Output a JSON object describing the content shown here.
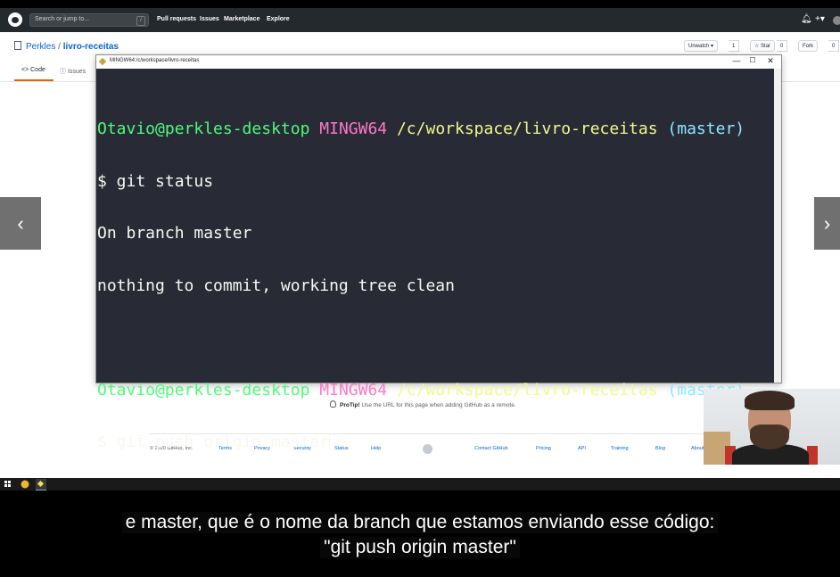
{
  "github": {
    "search_placeholder": "Search or jump to...",
    "search_key": "/",
    "nav": [
      "Pull requests",
      "Issues",
      "Marketplace",
      "Explore"
    ],
    "right_icons": [
      "bell-icon",
      "plus-icon",
      "avatar"
    ]
  },
  "repo": {
    "owner": "Perkles",
    "separator": " / ",
    "name": "livro-receitas",
    "unwatch_label": "Unwatch ▾",
    "unwatch_count": "1",
    "star_label": "☆ Star",
    "star_count": "0",
    "fork_label": "Fork",
    "fork_count": "0",
    "tabs": [
      "<> Code",
      "ⓘ Issues"
    ]
  },
  "protip": {
    "bold": "ProTip!",
    "text": " Use the URL for this page when adding GitHub as a remote."
  },
  "footer": {
    "copyright": "© 2020 GitHub, Inc.",
    "left_links": [
      "Terms",
      "Privacy",
      "Security",
      "Status",
      "Help"
    ],
    "right_links": [
      "Contact GitHub",
      "Pricing",
      "API",
      "Training",
      "Blog",
      "About"
    ]
  },
  "terminal": {
    "title": "MINGW64:/c/workspace/livro-receitas",
    "controls": [
      "—",
      "☐",
      "✕"
    ],
    "prompt1": {
      "user": "Otavio@perkles-desktop",
      "env": "MINGW64",
      "path": "/c/workspace/livro-receitas",
      "branch": "(master)"
    },
    "cmd1": "$ git status",
    "out1": "On branch master",
    "out2": "nothing to commit, working tree clean",
    "prompt2": {
      "user": "Otavio@perkles-desktop",
      "env": "MINGW64",
      "path": "/c/workspace/livro-receitas",
      "branch": "(master)"
    },
    "cmd2": "$ git push origin master"
  },
  "carousel": {
    "prev_label": "‹",
    "next_label": "›"
  },
  "subtitles": {
    "line1": "e master, que é o nome da branch que estamos enviando esse código:",
    "line2": "\"git push origin master\""
  },
  "colors": {
    "terminal_bg": "#282a36",
    "prompt_user": "#50fa7b",
    "prompt_env": "#ff79c6",
    "prompt_path": "#f1fa8c",
    "prompt_branch": "#8be9fd",
    "github_header": "#24292e"
  }
}
